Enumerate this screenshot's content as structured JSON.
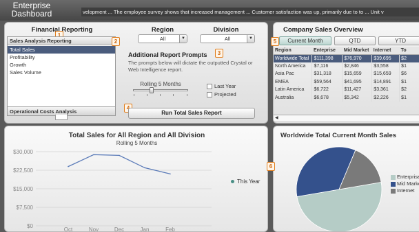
{
  "app": {
    "title_line1": "Enterprise",
    "title_line2": "Dashboard",
    "ticker": "velopment ... The employee survey shows that increased management ... Customer satisfaction was up, primarily due to to ... Unit v"
  },
  "filters": {
    "financial_reporting_header": "Financial Reporting",
    "region_header": "Region",
    "division_header": "Division",
    "region_value": "All",
    "division_value": "All",
    "list_group_title": "Sales Analysis Reporting",
    "list_items": [
      "Total Sales",
      "Profitability",
      "Growth",
      "Sales Volume"
    ],
    "selected_item": "Total Sales",
    "list_group_footer": "Operational Costs Analysis",
    "badges": [
      "1",
      "2",
      "3",
      "4",
      "5",
      "6"
    ]
  },
  "prompts": {
    "title": "Additional Report Prompts",
    "description": "The prompts below will dictate the outputted Crystal or Web Intelligence report.",
    "slider_label": "Rolling 5 Months",
    "checkbox_last_year": "Last Year",
    "checkbox_projected": "Projected",
    "run_button": "Run Total Sales Report"
  },
  "chart": {
    "title": "Total Sales for All Region and All Division",
    "subtitle": "Rolling 5 Months",
    "legend": "This Year"
  },
  "chart_data": [
    {
      "type": "line",
      "title": "Total Sales for All Region and All Division",
      "subtitle": "Rolling 5 Months",
      "categories": [
        "Oct",
        "Nov",
        "Dec",
        "Jan",
        "Feb"
      ],
      "y_ticks": [
        "$30,000",
        "$22,500",
        "$15,000",
        "$7,500",
        "$0"
      ],
      "ylim": [
        0,
        30000
      ],
      "series": [
        {
          "name": "This Year",
          "values": [
            24000,
            28800,
            28500,
            23500,
            21000
          ],
          "color": "#5a7ab8"
        }
      ],
      "grid": true,
      "legend_position": "right"
    },
    {
      "type": "pie",
      "title": "Worldwide Total Current Month Sales",
      "labels": [
        "Enterprise",
        "Mid Market",
        "Internet"
      ],
      "values": [
        50,
        34,
        16
      ],
      "colors": [
        "#b5ccc6",
        "#34518c",
        "#7a7a7a"
      ],
      "legend_position": "right"
    }
  ],
  "overview": {
    "title": "Company Sales Overview",
    "tabs": [
      "Current Month",
      "QTD",
      "YTD"
    ],
    "columns": [
      "Region",
      "Enteprise",
      "Mid Market",
      "Internet",
      "To"
    ],
    "rows": [
      [
        "Worldwide Total",
        "$111,398",
        "$76,970",
        "$39,695",
        "$2"
      ],
      [
        "North America",
        "$7,116",
        "$2,846",
        "$3,558",
        "$1"
      ],
      [
        "Asia Pac",
        "$31,318",
        "$15,659",
        "$15,659",
        "$6"
      ],
      [
        "EMEA",
        "$59,564",
        "$41,695",
        "$14,891",
        "$1"
      ],
      [
        "Latin America",
        "$6,722",
        "$11,427",
        "$3,361",
        "$2"
      ],
      [
        "Australia",
        "$6,678",
        "$5,342",
        "$2,226",
        "$1"
      ]
    ],
    "selected_row": "Worldwide Total"
  },
  "pie": {
    "title": "Worldwide Total Current Month Sales",
    "legend": [
      "Enterprise",
      "Mid Market",
      "Internet"
    ]
  },
  "colors": {
    "selection": "#4a5c7d",
    "accent_badge": "#e07c1a",
    "line": "#5a7ab8",
    "legend_dot": "#4a8f86"
  }
}
